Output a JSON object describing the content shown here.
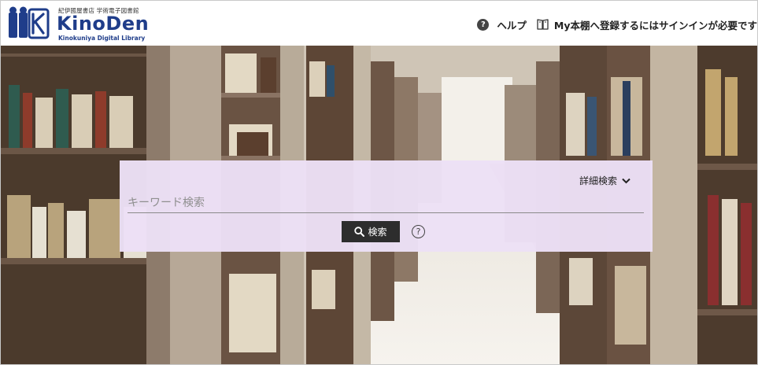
{
  "header": {
    "logo": {
      "org_jp": "紀伊國屋書店 学術電子図書館",
      "name": "KinoDen",
      "subtitle": "Kinokuniya Digital Library"
    },
    "help_label": "ヘルプ",
    "myshelf_label": "My本棚へ登録するにはサインインが必要です"
  },
  "search": {
    "advanced_label": "詳細検索",
    "placeholder": "キーワード検索",
    "value": "",
    "button_label": "検索",
    "help_symbol": "?"
  },
  "colors": {
    "brand": "#1f3d8a",
    "panel": "#ece0f6",
    "button": "#2d2d2d"
  },
  "icons": [
    "kinoden-logo-icon",
    "help-circle-icon",
    "bookshelf-icon",
    "chevron-down-icon",
    "search-icon",
    "question-circle-icon"
  ]
}
